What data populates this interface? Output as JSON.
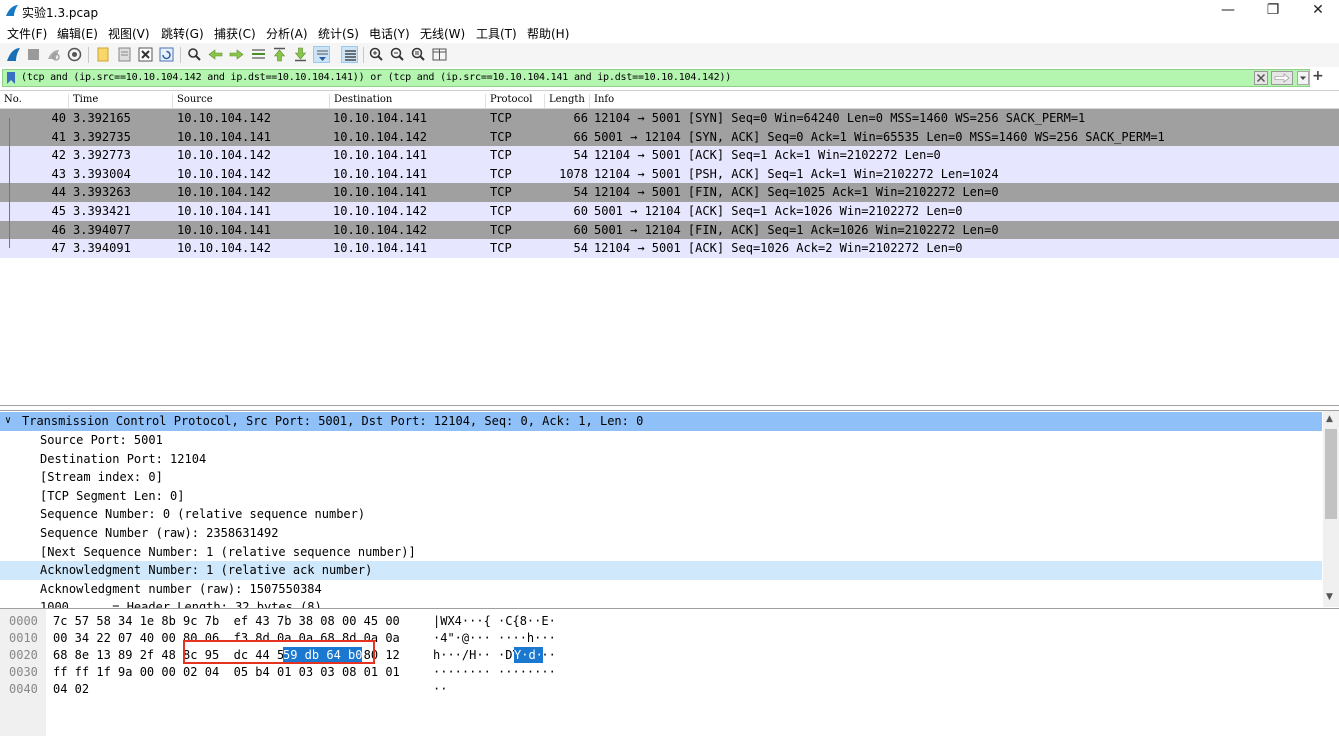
{
  "window": {
    "title": "实验1.3.pcap",
    "controls": {
      "minimize": "—",
      "maximize": "❐",
      "close": "✕"
    }
  },
  "menu": {
    "items": [
      "文件(F)",
      "编辑(E)",
      "视图(V)",
      "跳转(G)",
      "捕获(C)",
      "分析(A)",
      "统计(S)",
      "电话(Y)",
      "无线(W)",
      "工具(T)",
      "帮助(H)"
    ]
  },
  "toolbar": {
    "icons": [
      "start-capture-icon",
      "stop-capture-icon",
      "restart-capture-icon",
      "capture-options-icon",
      "open-file-icon",
      "save-file-icon",
      "close-file-icon",
      "reload-file-icon",
      "find-packet-icon",
      "go-back-icon",
      "go-forward-icon",
      "go-to-packet-icon",
      "go-first-icon",
      "go-last-icon",
      "autoscroll-icon",
      "colorize-icon",
      "zoom-in-icon",
      "zoom-out-icon",
      "zoom-normal-icon",
      "resize-columns-icon"
    ]
  },
  "filter": {
    "text": "(tcp and (ip.src==10.10.104.142 and ip.dst==10.10.104.141)) or (tcp and (ip.src==10.10.104.141 and ip.dst==10.10.104.142))",
    "background": "#b4f5b0"
  },
  "packet_list": {
    "columns": [
      "No.",
      "Time",
      "Source",
      "Destination",
      "Protocol",
      "Length",
      "Info"
    ],
    "rows": [
      {
        "no": "40",
        "time": "3.392165",
        "src": "10.10.104.142",
        "dst": "10.10.104.141",
        "proto": "TCP",
        "len": "66",
        "info": "12104 → 5001 [SYN] Seq=0 Win=64240 Len=0 MSS=1460 WS=256 SACK_PERM=1",
        "bg": "#a0a0a0"
      },
      {
        "no": "41",
        "time": "3.392735",
        "src": "10.10.104.141",
        "dst": "10.10.104.142",
        "proto": "TCP",
        "len": "66",
        "info": "5001 → 12104 [SYN, ACK] Seq=0 Ack=1 Win=65535 Len=0 MSS=1460 WS=256 SACK_PERM=1",
        "bg": "#a0a0a0"
      },
      {
        "no": "42",
        "time": "3.392773",
        "src": "10.10.104.142",
        "dst": "10.10.104.141",
        "proto": "TCP",
        "len": "54",
        "info": "12104 → 5001 [ACK] Seq=1 Ack=1 Win=2102272 Len=0",
        "bg": "#e7e6ff"
      },
      {
        "no": "43",
        "time": "3.393004",
        "src": "10.10.104.142",
        "dst": "10.10.104.141",
        "proto": "TCP",
        "len": "1078",
        "info": "12104 → 5001 [PSH, ACK] Seq=1 Ack=1 Win=2102272 Len=1024",
        "bg": "#e7e6ff"
      },
      {
        "no": "44",
        "time": "3.393263",
        "src": "10.10.104.142",
        "dst": "10.10.104.141",
        "proto": "TCP",
        "len": "54",
        "info": "12104 → 5001 [FIN, ACK] Seq=1025 Ack=1 Win=2102272 Len=0",
        "bg": "#a0a0a0"
      },
      {
        "no": "45",
        "time": "3.393421",
        "src": "10.10.104.141",
        "dst": "10.10.104.142",
        "proto": "TCP",
        "len": "60",
        "info": "5001 → 12104 [ACK] Seq=1 Ack=1026 Win=2102272 Len=0",
        "bg": "#e7e6ff"
      },
      {
        "no": "46",
        "time": "3.394077",
        "src": "10.10.104.141",
        "dst": "10.10.104.142",
        "proto": "TCP",
        "len": "60",
        "info": "5001 → 12104 [FIN, ACK] Seq=1 Ack=1026 Win=2102272 Len=0",
        "bg": "#a0a0a0"
      },
      {
        "no": "47",
        "time": "3.394091",
        "src": "10.10.104.142",
        "dst": "10.10.104.141",
        "proto": "TCP",
        "len": "54",
        "info": "12104 → 5001 [ACK] Seq=1026 Ack=2 Win=2102272 Len=0",
        "bg": "#e7e6ff"
      }
    ]
  },
  "details": {
    "header": "Transmission Control Protocol, Src Port: 5001, Dst Port: 12104, Seq: 0, Ack: 1, Len: 0",
    "fields": [
      "Source Port: 5001",
      "Destination Port: 12104",
      "[Stream index: 0]",
      "[TCP Segment Len: 0]",
      "Sequence Number: 0    (relative sequence number)",
      "Sequence Number (raw): 2358631492",
      "[Next Sequence Number: 1    (relative sequence number)]",
      "Acknowledgment Number: 1    (relative ack number)",
      "Acknowledgment number (raw): 1507550384",
      "1000 .... = Header Length: 32 bytes (8)"
    ],
    "selected_index": 7
  },
  "hex": {
    "rows": [
      {
        "offset": "0000",
        "bytes": "7c 57 58 34 1e 8b 9c 7b  ef 43 7b 38 08 00 45 00",
        "ascii": "|WX4···{ ·C{8··E·"
      },
      {
        "offset": "0010",
        "bytes": "00 34 22 07 40 00 80 06  f3 8d 0a 0a 68 8d 0a 0a",
        "ascii": "·4\"·@··· ····h···"
      },
      {
        "offset": "0020",
        "bytes": "68 8e 13 89 2f 48 8c 95  dc 44 59 db 64 b0 80 12",
        "ascii": "h···/H·· ·DY·d···"
      },
      {
        "offset": "0030",
        "bytes": "ff ff 1f 9a 00 00 02 04  05 b4 01 03 03 08 01 01",
        "ascii": "········ ········"
      },
      {
        "offset": "0040",
        "bytes": "04 02",
        "ascii": "··"
      }
    ],
    "selected_bytes": "59 db 64 b0",
    "selected_ascii": "Y·d·"
  }
}
